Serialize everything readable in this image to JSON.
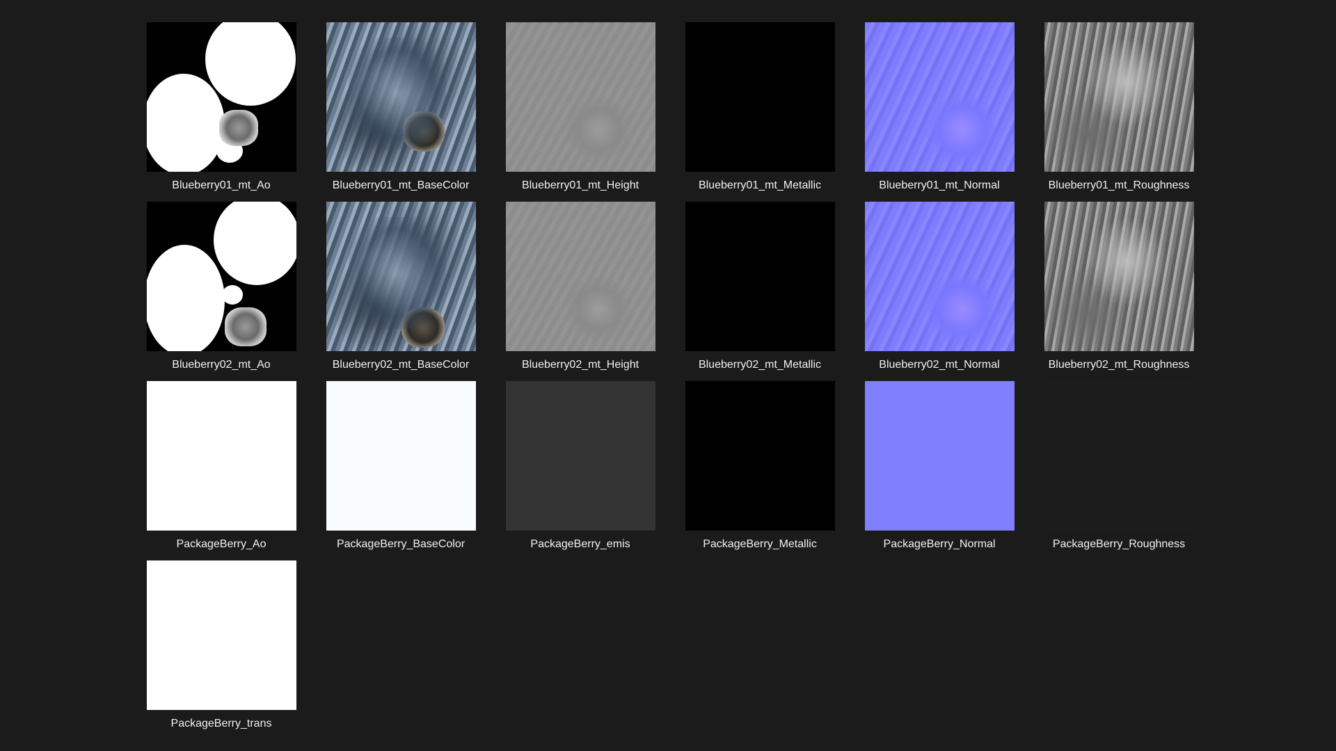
{
  "files": [
    {
      "label": "Blueberry01_mt_Ao",
      "kind": "ao1"
    },
    {
      "label": "Blueberry01_mt_BaseColor",
      "kind": "base"
    },
    {
      "label": "Blueberry01_mt_Height",
      "kind": "height"
    },
    {
      "label": "Blueberry01_mt_Metallic",
      "kind": "metal"
    },
    {
      "label": "Blueberry01_mt_Normal",
      "kind": "normal"
    },
    {
      "label": "Blueberry01_mt_Roughness",
      "kind": "rough"
    },
    {
      "label": "Blueberry02_mt_Ao",
      "kind": "ao2"
    },
    {
      "label": "Blueberry02_mt_BaseColor",
      "kind": "base"
    },
    {
      "label": "Blueberry02_mt_Height",
      "kind": "height"
    },
    {
      "label": "Blueberry02_mt_Metallic",
      "kind": "metal"
    },
    {
      "label": "Blueberry02_mt_Normal",
      "kind": "normal"
    },
    {
      "label": "Blueberry02_mt_Roughness",
      "kind": "rough"
    },
    {
      "label": "PackageBerry_Ao",
      "kind": "white"
    },
    {
      "label": "PackageBerry_BaseColor",
      "kind": "offwhite"
    },
    {
      "label": "PackageBerry_emis",
      "kind": "emis"
    },
    {
      "label": "PackageBerry_Metallic",
      "kind": "metal"
    },
    {
      "label": "PackageBerry_Normal",
      "kind": "flatnormal"
    },
    {
      "label": "PackageBerry_Roughness",
      "kind": "darkrough"
    },
    {
      "label": "PackageBerry_trans",
      "kind": "white"
    }
  ],
  "colors": {
    "background": "#1b1b1b",
    "label_text": "#f2f2f2",
    "normal_map": "#8080ff"
  }
}
